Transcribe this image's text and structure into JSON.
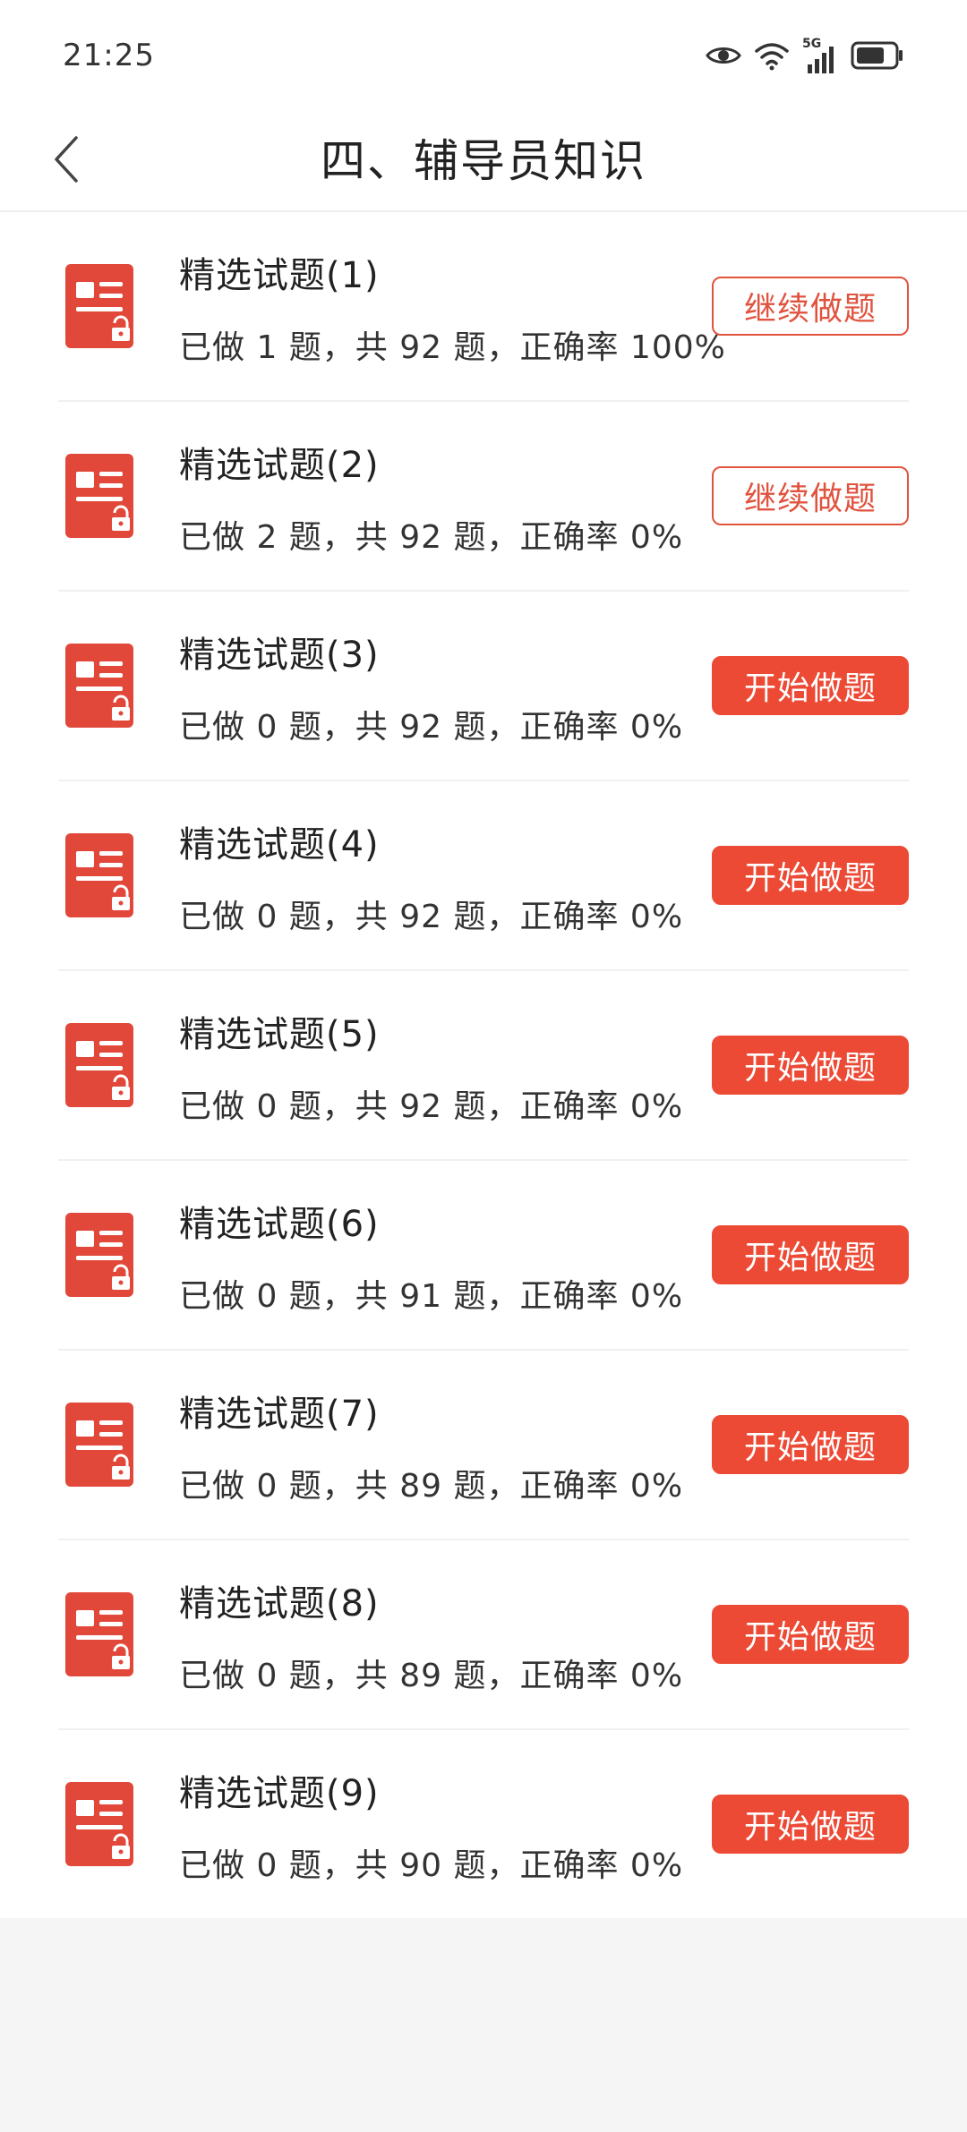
{
  "status_bar": {
    "time": "21:25",
    "network_label": "5G"
  },
  "header": {
    "title": "四、辅导员知识"
  },
  "items": [
    {
      "title": "精选试题(1)",
      "summary": "已做 1 题，共 92 题，正确率 100%",
      "action": "继续做题",
      "state": "continue"
    },
    {
      "title": "精选试题(2)",
      "summary": "已做 2 题，共 92 题，正确率 0%",
      "action": "继续做题",
      "state": "continue"
    },
    {
      "title": "精选试题(3)",
      "summary": "已做 0 题，共 92 题，正确率 0%",
      "action": "开始做题",
      "state": "start"
    },
    {
      "title": "精选试题(4)",
      "summary": "已做 0 题，共 92 题，正确率 0%",
      "action": "开始做题",
      "state": "start"
    },
    {
      "title": "精选试题(5)",
      "summary": "已做 0 题，共 92 题，正确率 0%",
      "action": "开始做题",
      "state": "start"
    },
    {
      "title": "精选试题(6)",
      "summary": "已做 0 题，共 91 题，正确率 0%",
      "action": "开始做题",
      "state": "start"
    },
    {
      "title": "精选试题(7)",
      "summary": "已做 0 题，共 89 题，正确率 0%",
      "action": "开始做题",
      "state": "start"
    },
    {
      "title": "精选试题(8)",
      "summary": "已做 0 题，共 89 题，正确率 0%",
      "action": "开始做题",
      "state": "start"
    },
    {
      "title": "精选试题(9)",
      "summary": "已做 0 题，共 90 题，正确率 0%",
      "action": "开始做题",
      "state": "start"
    }
  ],
  "colors": {
    "accent": "#ec4a35",
    "accent_outline": "#e0533f",
    "icon_red": "#e1483a",
    "divider": "#f0f0f0",
    "page_bg": "#f5f5f5"
  },
  "icons": {
    "back": "chevron-left-icon",
    "item": "exam-paper-lock-icon"
  }
}
